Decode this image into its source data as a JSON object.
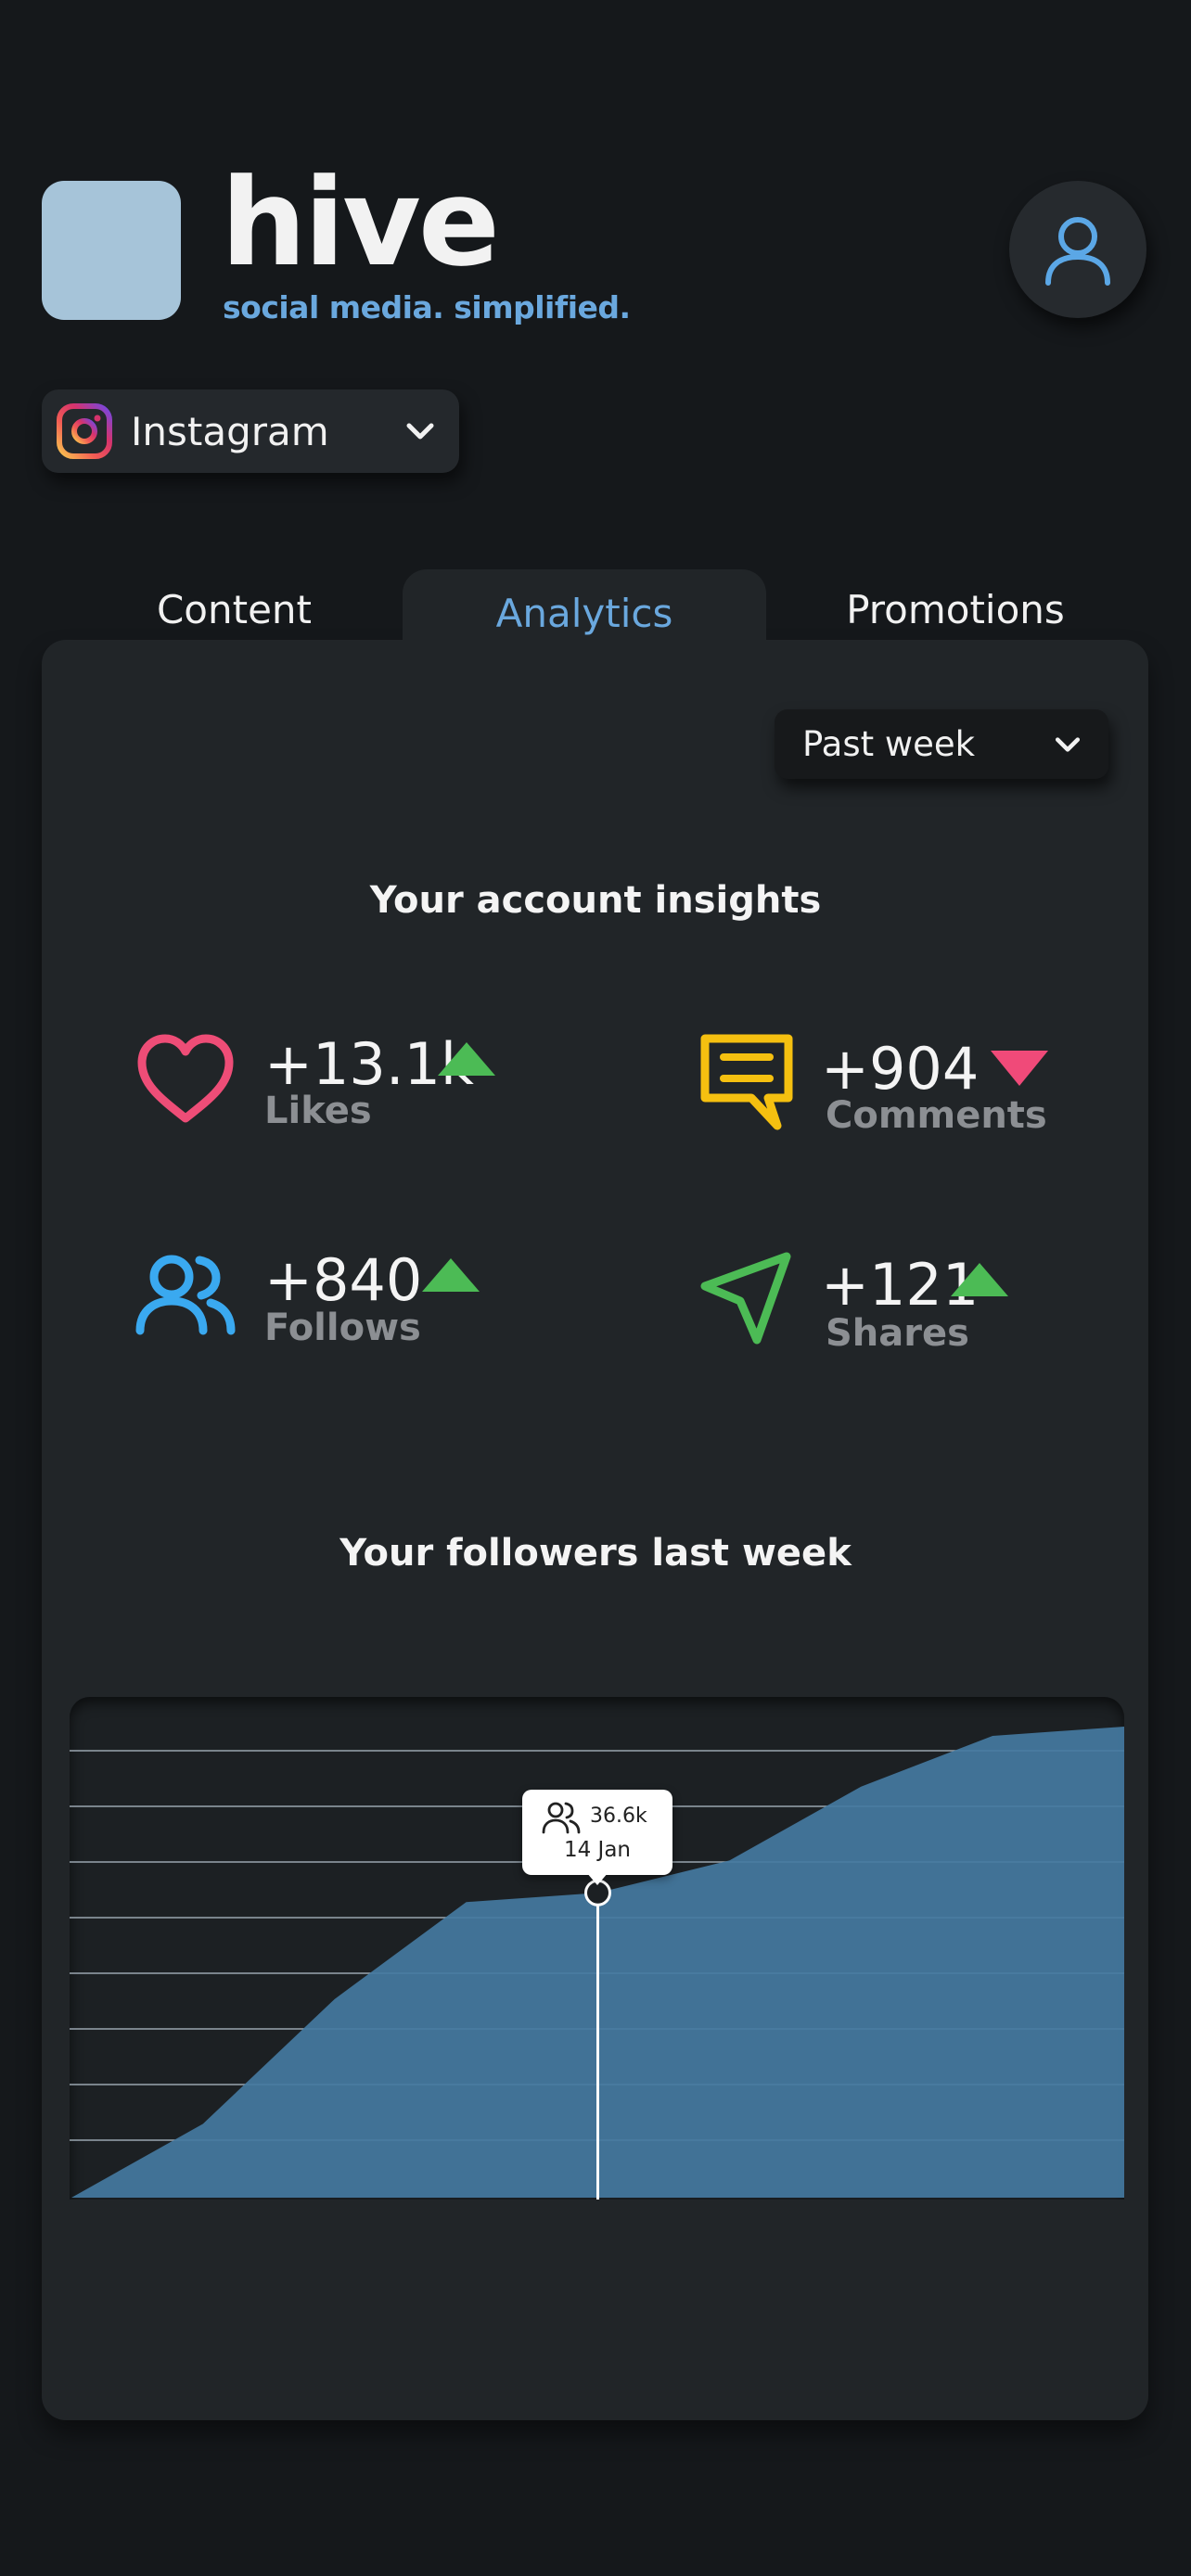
{
  "brand": {
    "name": "hive",
    "tagline": "social media. simplified.",
    "logo_color": "#a6c4d9"
  },
  "header": {
    "profile_icon": "user-icon"
  },
  "platform_selector": {
    "selected": "Instagram",
    "icon": "instagram-icon",
    "chevron_icon": "chevron-down-icon"
  },
  "tabs": [
    {
      "label": "Content",
      "active": false
    },
    {
      "label": "Analytics",
      "active": true
    },
    {
      "label": "Promotions",
      "active": false
    }
  ],
  "period_selector": {
    "selected": "Past week",
    "chevron_icon": "chevron-down-icon"
  },
  "insights": {
    "title": "Your account insights",
    "stats": [
      {
        "value": "+13.1k",
        "label": "Likes",
        "trend": "up",
        "icon": "heart-icon",
        "color": "#ee4d77"
      },
      {
        "value": "+904",
        "label": "Comments",
        "trend": "down",
        "icon": "comment-icon",
        "color": "#f5c010"
      },
      {
        "value": "+840",
        "label": "Follows",
        "trend": "up",
        "icon": "users-icon",
        "color": "#3aa9f0"
      },
      {
        "value": "+121",
        "label": "Shares",
        "trend": "up",
        "icon": "send-icon",
        "color": "#4cbb55"
      }
    ],
    "trend_colors": {
      "up": "#4cbb55",
      "down": "#f04a79"
    }
  },
  "followers": {
    "title": "Your followers last week",
    "tooltip": {
      "count": "36.6k",
      "date": "14 Jan",
      "icon": "users-icon"
    }
  },
  "chart_data": {
    "type": "area",
    "series": [
      {
        "values": [
          0.0,
          0.16,
          0.43,
          0.64,
          0.66,
          0.73,
          0.89,
          1.0,
          1.02
        ]
      }
    ],
    "highlight_index": 4,
    "grid": true,
    "fill_color": "#447aa1"
  }
}
